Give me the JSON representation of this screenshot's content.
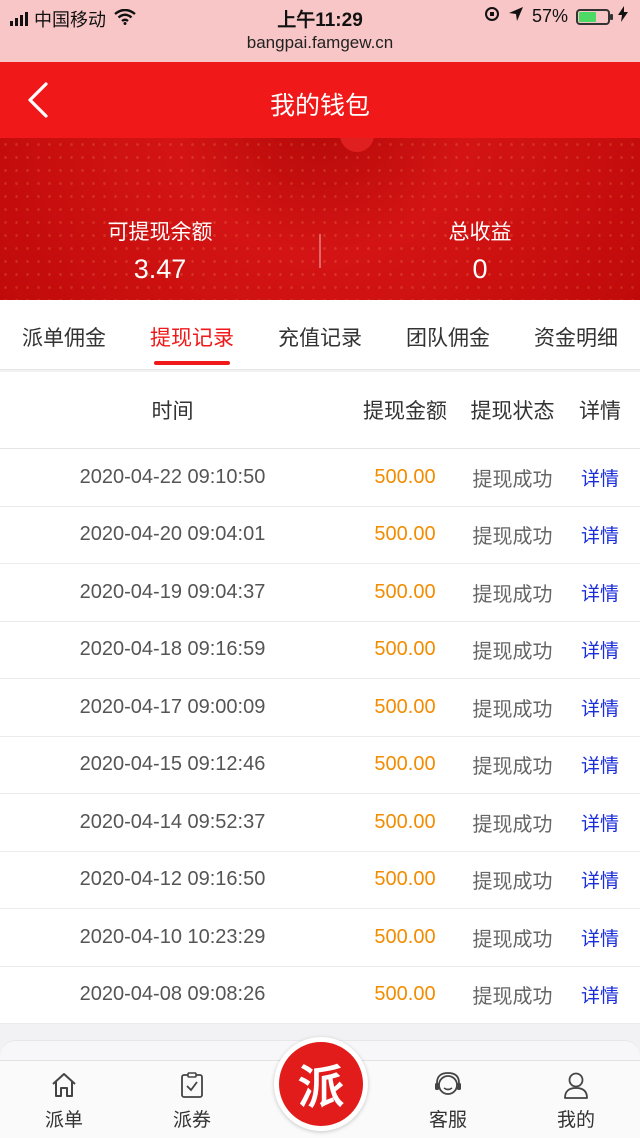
{
  "status_bar": {
    "carrier": "中国移动",
    "time": "上午11:29",
    "url": "bangpai.famgew.cn",
    "battery_percent": "57%",
    "battery_level": 0.57
  },
  "header": {
    "title": "我的钱包"
  },
  "balance": {
    "withdrawable_label": "可提现余额",
    "withdrawable_value": "3.47",
    "total_label": "总收益",
    "total_value": "0"
  },
  "tabs": [
    {
      "label": "派单佣金"
    },
    {
      "label": "提现记录"
    },
    {
      "label": "充值记录"
    },
    {
      "label": "团队佣金"
    },
    {
      "label": "资金明细"
    }
  ],
  "table": {
    "headers": {
      "time": "时间",
      "amount": "提现金额",
      "status": "提现状态",
      "detail": "详情"
    },
    "rows": [
      {
        "time": "2020-04-22 09:10:50",
        "amount": "500.00",
        "status": "提现成功",
        "detail": "详情"
      },
      {
        "time": "2020-04-20 09:04:01",
        "amount": "500.00",
        "status": "提现成功",
        "detail": "详情"
      },
      {
        "time": "2020-04-19 09:04:37",
        "amount": "500.00",
        "status": "提现成功",
        "detail": "详情"
      },
      {
        "time": "2020-04-18 09:16:59",
        "amount": "500.00",
        "status": "提现成功",
        "detail": "详情"
      },
      {
        "time": "2020-04-17 09:00:09",
        "amount": "500.00",
        "status": "提现成功",
        "detail": "详情"
      },
      {
        "time": "2020-04-15 09:12:46",
        "amount": "500.00",
        "status": "提现成功",
        "detail": "详情"
      },
      {
        "time": "2020-04-14 09:52:37",
        "amount": "500.00",
        "status": "提现成功",
        "detail": "详情"
      },
      {
        "time": "2020-04-12 09:16:50",
        "amount": "500.00",
        "status": "提现成功",
        "detail": "详情"
      },
      {
        "time": "2020-04-10 10:23:29",
        "amount": "500.00",
        "status": "提现成功",
        "detail": "详情"
      },
      {
        "time": "2020-04-08 09:08:26",
        "amount": "500.00",
        "status": "提现成功",
        "detail": "详情"
      }
    ]
  },
  "bottom_nav": {
    "items": [
      {
        "label": "派单",
        "icon": "home-icon"
      },
      {
        "label": "派券",
        "icon": "clipboard-check-icon"
      },
      {
        "label": "客服",
        "icon": "headset-icon"
      },
      {
        "label": "我的",
        "icon": "user-icon"
      }
    ],
    "center_button": "派"
  },
  "colors": {
    "primary": "#f01818",
    "amount": "#f28c00",
    "link": "#1a2ddb"
  }
}
